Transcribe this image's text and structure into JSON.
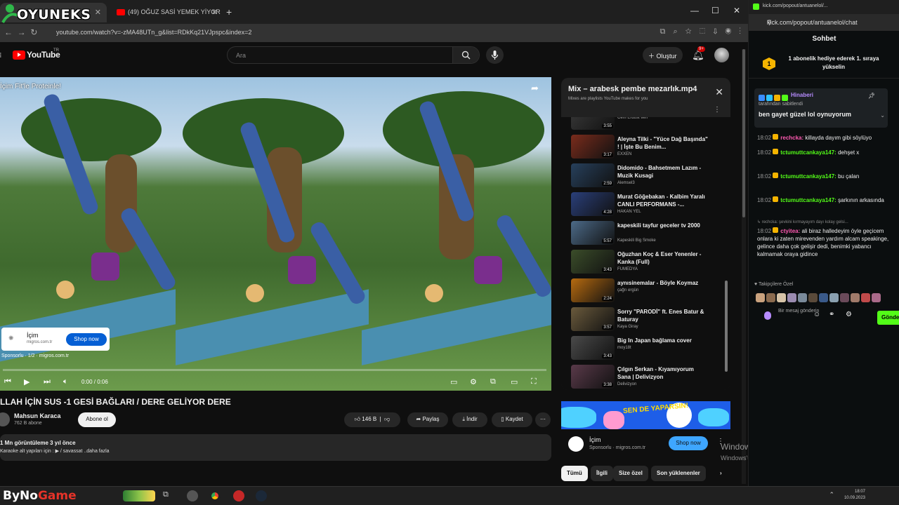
{
  "overlay": {
    "logo_text": "OYUNEKS"
  },
  "browser": {
    "tabs": [
      {
        "label": ""
      },
      {
        "label": "(49) OĞUZ SASİ YEMEK YİYOR"
      }
    ],
    "url": "youtube.com/watch?v=-zMA48UTn_g&list=RDkKq21VJpspc&index=2"
  },
  "youtube": {
    "wordmark": "YouTube",
    "country": "TR",
    "search_placeholder": "Ara",
    "create_label": "Oluştur",
    "notification_count": "9+",
    "video": {
      "caption": "İçim Fit'le Proteinle!",
      "ad_card": {
        "name": "İçim",
        "domain": "migros.com.tr",
        "button": "Shop now"
      },
      "sponsor_line": "Sponsorlu · 1/2 · migros.com.tr",
      "time": "0:00 / 0:06",
      "progress": 0.0
    },
    "title": "LLAH İÇİN SUS -1 GESİ BAĞLARI / DERE GELİYOR DERE",
    "channel": {
      "name": "Mahsun Karaca",
      "subs": "762 B abone"
    },
    "subscribe_label": "Abone ol",
    "likes": "146 B",
    "share_label": "Paylaş",
    "download_label": "İndir",
    "save_label": "Kaydet",
    "description": {
      "meta": "1 Mn görüntüleme  3 yıl önce",
      "text": "Karaoke alt yapıları için : ▶ / savassat ..daha fazla"
    },
    "playlist": {
      "title": "Mix – arabesk pembe mezarlık.mp4",
      "subtitle": "Mixes are playlists YouTube makes for you",
      "items": [
        {
          "title": "",
          "channel": "Cem Erdost İlerl",
          "duration": "3:55"
        },
        {
          "title": "Aleyna Tilki - \"Yüce Dağ Başında\" ! | İşte Bu Benim...",
          "channel": "EXXEN",
          "duration": "3:17"
        },
        {
          "title": "Didomido - Bahsetmem Lazım - Muzik Kusagi",
          "channel": "Alemsel3",
          "duration": "2:59"
        },
        {
          "title": "Murat Göğebakan - Kalbim Yaralı CANLI PERFORMANS -...",
          "channel": "HAKAN YEL",
          "duration": "4:28"
        },
        {
          "title": "kapeskili tayfur geceler tv 2000",
          "channel": "Kapeskili Big Smoke",
          "duration": "5:57"
        },
        {
          "title": "Oğuzhan Koç & Eser Yenenler - Kanka (Full)",
          "channel": "FUMEDYA",
          "duration": "3:43"
        },
        {
          "title": "aynısinemalar - Böyle Koymaz",
          "channel": "çağrı ergün",
          "duration": "2:24"
        },
        {
          "title": "Sorry \"PARODİ\" ft. Enes Batur & Baturay",
          "channel": "Kaya Giray",
          "duration": "3:57"
        },
        {
          "title": "Big In Japan bağlama cover",
          "channel": "moy18t",
          "duration": "3:43"
        },
        {
          "title": "Çılgın Serkan - Kıyamıyorum Sana | Delivizyon",
          "channel": "Delivizyon",
          "duration": "3:38"
        }
      ]
    },
    "banner_ad": {
      "headline": "SEN DE YAPARSIN!",
      "name": "İçim",
      "domain": "Sponsorlu · migros.com.tr",
      "button": "Shop now"
    },
    "chips": [
      "Tümü",
      "İlgili",
      "Size özel",
      "Son yüklenenler"
    ]
  },
  "windows_watermark": {
    "line1": "Windows'u Etkinleştir",
    "line2": "Windows'u etkinleştirmek için Ayarlar'a gidin."
  },
  "kick": {
    "tab_label": "kick.com/popout/antuanelol/...",
    "url": "kick.com/popout/antuanelol/chat",
    "header": "Sohbet",
    "goal_badge": "1",
    "goal_text": "1 abonelik hediye ederek 1. sıraya yükselin",
    "pinned": {
      "user": "Hinaberi",
      "by": "tarafından sabitlendi",
      "message": "ben gayet güzel lol oynuyorum"
    },
    "messages": [
      {
        "time": "18:02",
        "user": "rechcka:",
        "text": "killayda dayım gibi söylüyo",
        "color": "#ff5ab2"
      },
      {
        "time": "18:02",
        "user": "tctumuttcankaya147:",
        "text": "dehşet x",
        "color": "#53fc18"
      },
      {
        "time": "18:02",
        "user": "tctumuttcankaya147:",
        "text": "bu çalan",
        "color": "#53fc18"
      },
      {
        "time": "18:02",
        "user": "tctumuttcankaya147:",
        "text": "şarkının arkasında",
        "color": "#53fc18"
      },
      {
        "time": "18:02",
        "user": "ctyitea:",
        "text": "ali biraz halledeyim öyle geçicem onlara ki zaten mirevenden yardım alcam speakinge, gelince daha çok gelişir dedi, benimki yabancı kalmamak oraya gidince",
        "color": "#ff5ab2"
      }
    ],
    "reply_hint": "↳ rechcka: şevkini kırmayayım dayı kolay gelsi...",
    "supporters_label": "♥ Takipçilere Özel",
    "input_placeholder": "Bir mesaj gönderin",
    "send_label": "Gönder"
  },
  "taskbar": {
    "brand_a": "ByNo",
    "brand_b": "Game",
    "time": "18:07",
    "date": "10.09.2023"
  }
}
